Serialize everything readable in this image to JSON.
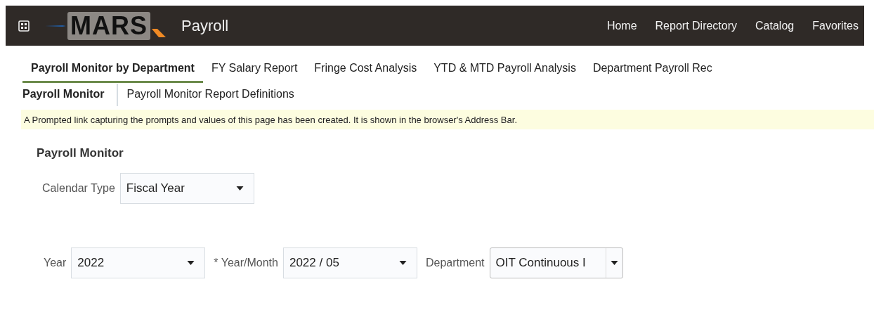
{
  "header": {
    "logo": "MARS",
    "app_title": "Payroll",
    "nav": [
      "Home",
      "Report Directory",
      "Catalog",
      "Favorites"
    ]
  },
  "tabs": [
    {
      "label": "Payroll Monitor by Department",
      "selected": true
    },
    {
      "label": "FY Salary Report",
      "selected": false
    },
    {
      "label": "Fringe Cost Analysis",
      "selected": false
    },
    {
      "label": "YTD & MTD Payroll Analysis",
      "selected": false
    },
    {
      "label": "Department Payroll Rec",
      "selected": false
    }
  ],
  "subtabs": [
    {
      "label": "Payroll Monitor",
      "selected": true
    },
    {
      "label": "Payroll Monitor Report Definitions",
      "selected": false
    }
  ],
  "notice": "A Prompted link capturing the prompts and values of this page has been created. It is shown in the browser's Address Bar.",
  "section_title": "Payroll Monitor",
  "calendar_type": {
    "label": "Calendar Type",
    "value": "Fiscal Year"
  },
  "prompts": [
    {
      "label": "Year",
      "value": "2022"
    },
    {
      "label": "* Year/Month",
      "value": "2022 / 05"
    },
    {
      "label": "Department",
      "value": "OIT Continuous I"
    }
  ]
}
